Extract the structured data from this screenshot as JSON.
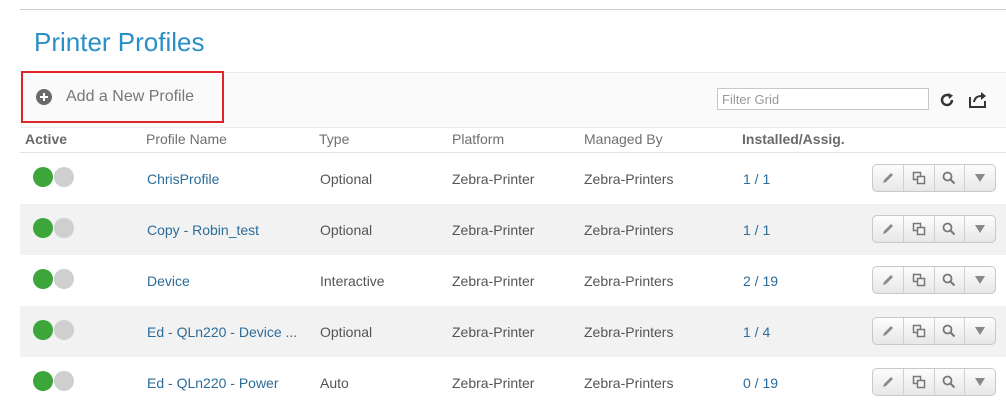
{
  "page": {
    "title": "Printer Profiles"
  },
  "toolbar": {
    "add_label": "Add a New Profile",
    "filter_placeholder": "Filter Grid"
  },
  "columns": [
    "Active",
    "Profile Name",
    "Type",
    "Platform",
    "Managed By",
    "Installed/Assig."
  ],
  "rows": [
    {
      "active": true,
      "name": "ChrisProfile",
      "type": "Optional",
      "platform": "Zebra-Printer",
      "managed_by": "Zebra-Printers",
      "installed": "1 / 1"
    },
    {
      "active": true,
      "name": "Copy - Robin_test",
      "type": "Optional",
      "platform": "Zebra-Printer",
      "managed_by": "Zebra-Printers",
      "installed": "1 / 1"
    },
    {
      "active": true,
      "name": "Device",
      "type": "Interactive",
      "platform": "Zebra-Printer",
      "managed_by": "Zebra-Printers",
      "installed": "2 / 19"
    },
    {
      "active": true,
      "name": "Ed - QLn220 - Device ...",
      "type": "Optional",
      "platform": "Zebra-Printer",
      "managed_by": "Zebra-Printers",
      "installed": "1 / 4"
    },
    {
      "active": true,
      "name": "Ed - QLn220 - Power",
      "type": "Auto",
      "platform": "Zebra-Printer",
      "managed_by": "Zebra-Printers",
      "installed": "0 / 19"
    }
  ],
  "colors": {
    "title": "#2a8fc7",
    "link": "#2a6c9a",
    "active_on": "#3ca63a",
    "active_off": "#cfcfcf",
    "highlight": "#e0232b"
  },
  "icons": {
    "add": "plus-circle-icon",
    "refresh": "refresh-icon",
    "export": "export-icon",
    "edit": "pencil-icon",
    "copy": "copy-icon",
    "view": "magnifier-icon",
    "more": "caret-down-icon"
  }
}
